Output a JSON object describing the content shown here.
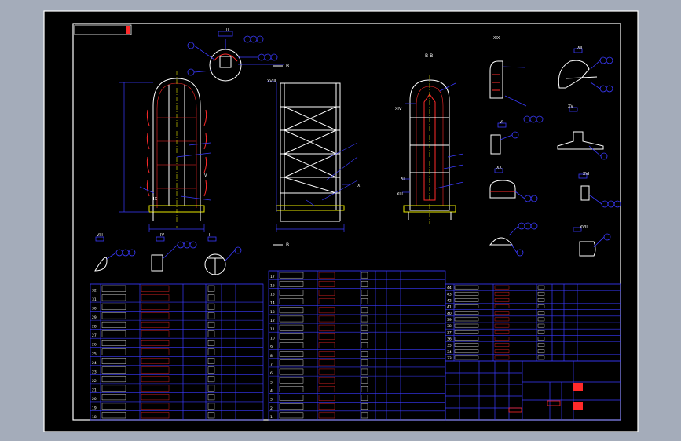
{
  "viewport": {
    "background": "#a4acba"
  },
  "drawing": {
    "background": "#000000",
    "frame_color": "#ffffff",
    "line_color": "#3a3aff",
    "accent_color": "#ff2a2a",
    "yellow_color": "#e8e800",
    "corner_mark": "标"
  },
  "views": {
    "section_label": "B-B",
    "b_cut_label": "B",
    "roman_labels": [
      "XVIII",
      "XIV",
      "XI",
      "XIII",
      "XVI",
      "XVII",
      "IV",
      "II",
      "VIII",
      "VI",
      "XII",
      "XV",
      "XX",
      "XIX",
      "III",
      "V",
      "IX",
      "X"
    ]
  },
  "parts_table": {
    "left_rows": [
      "32",
      "31",
      "30",
      "29",
      "28",
      "27",
      "26",
      "25",
      "24",
      "23",
      "22",
      "21",
      "20",
      "19",
      "18"
    ],
    "middle_rows": [
      "17",
      "16",
      "15",
      "14",
      "13",
      "12",
      "11",
      "10",
      "9",
      "8",
      "7",
      "6",
      "5",
      "4",
      "3",
      "2",
      "1"
    ],
    "right_rows": [
      "44",
      "43",
      "42",
      "41",
      "40",
      "39",
      "38",
      "37",
      "36",
      "35",
      "34",
      "33"
    ]
  },
  "title_block": {
    "drawing_title": "标",
    "school_mark": "标"
  }
}
